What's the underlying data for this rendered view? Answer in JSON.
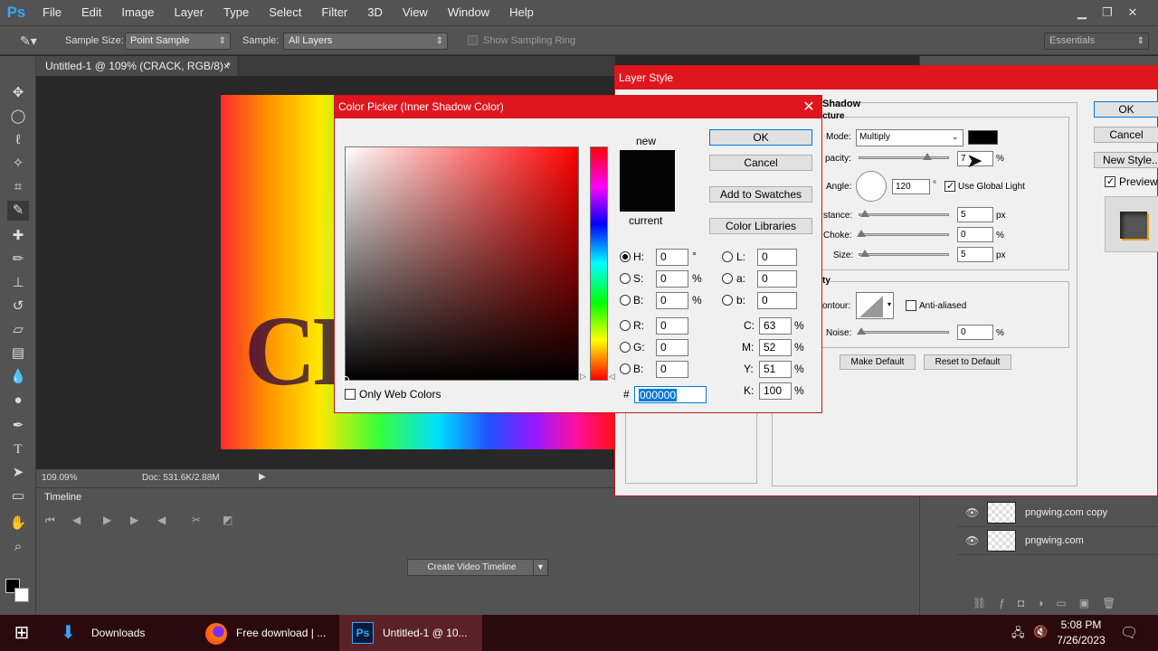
{
  "app": {
    "logo": "Ps"
  },
  "menu": [
    "File",
    "Edit",
    "Image",
    "Layer",
    "Type",
    "Select",
    "Filter",
    "3D",
    "View",
    "Window",
    "Help"
  ],
  "window_controls": {
    "minimize": "▁",
    "restore": "❐",
    "close": "✕"
  },
  "options": {
    "sample_size_label": "Sample Size:",
    "sample_size_value": "Point Sample",
    "sample_label": "Sample:",
    "sample_value": "All Layers",
    "show_ring_label": "Show Sampling Ring",
    "workspace_value": "Essentials"
  },
  "document": {
    "tab_title": "Untitled-1 @ 109% (CRACK, RGB/8) *",
    "tab_close": "×",
    "canvas_text": "CR",
    "zoom": "109.09%",
    "doc_size": "Doc: 531.6K/2.88M"
  },
  "timeline": {
    "tab": "Timeline",
    "create_button": "Create Video Timeline"
  },
  "layers": [
    {
      "name": "pngwing.com copy"
    },
    {
      "name": "pngwing.com"
    }
  ],
  "layer_style": {
    "title": "Layer Style",
    "section_title": "Shadow",
    "section_subtitle": "cture",
    "mode_label": "Mode:",
    "mode_value": "Multiply",
    "opacity_label": "pacity:",
    "opacity_value": "7",
    "opacity_unit": "%",
    "angle_label": "Angle:",
    "angle_value": "120",
    "angle_unit": "°",
    "use_global_light": "Use Global Light",
    "distance_label": "stance:",
    "distance_value": "5",
    "distance_unit": "px",
    "choke_label": "Choke:",
    "choke_value": "0",
    "choke_unit": "%",
    "size_label": "Size:",
    "size_value": "5",
    "size_unit": "px",
    "quality_title": "ty",
    "contour_label": "ontour:",
    "anti_aliased": "Anti-aliased",
    "noise_label": "Noise:",
    "noise_value": "0",
    "noise_unit": "%",
    "make_default": "Make Default",
    "reset_default": "Reset to Default",
    "ok": "OK",
    "cancel": "Cancel",
    "new_style": "New Style...",
    "preview": "Preview"
  },
  "color_picker": {
    "title": "Color Picker (Inner Shadow Color)",
    "close": "✕",
    "new_label": "new",
    "current_label": "current",
    "ok": "OK",
    "cancel": "Cancel",
    "add_to_swatches": "Add to Swatches",
    "color_libraries": "Color Libraries",
    "only_web_colors": "Only Web Colors",
    "new_color": "#050505",
    "current_color": "#050505",
    "fields": {
      "H": "0",
      "S": "0",
      "B": "0",
      "R": "0",
      "G": "0",
      "Bl": "0",
      "L": "0",
      "a": "0",
      "b": "0",
      "C": "63",
      "M": "52",
      "Y": "51",
      "K": "100"
    },
    "labels": {
      "H": "H:",
      "S": "S:",
      "B": "B:",
      "R": "R:",
      "G": "G:",
      "Bl": "B:",
      "L": "L:",
      "a": "a:",
      "b": "b:",
      "C": "C:",
      "M": "M:",
      "Y": "Y:",
      "K": "K:"
    },
    "units": {
      "deg": "°",
      "pct": "%"
    },
    "hash": "#",
    "hex": "000000"
  },
  "taskbar": {
    "items": [
      "Downloads",
      "Free download | ...",
      "Untitled-1 @ 10..."
    ],
    "time": "5:08 PM",
    "date": "7/26/2023"
  }
}
